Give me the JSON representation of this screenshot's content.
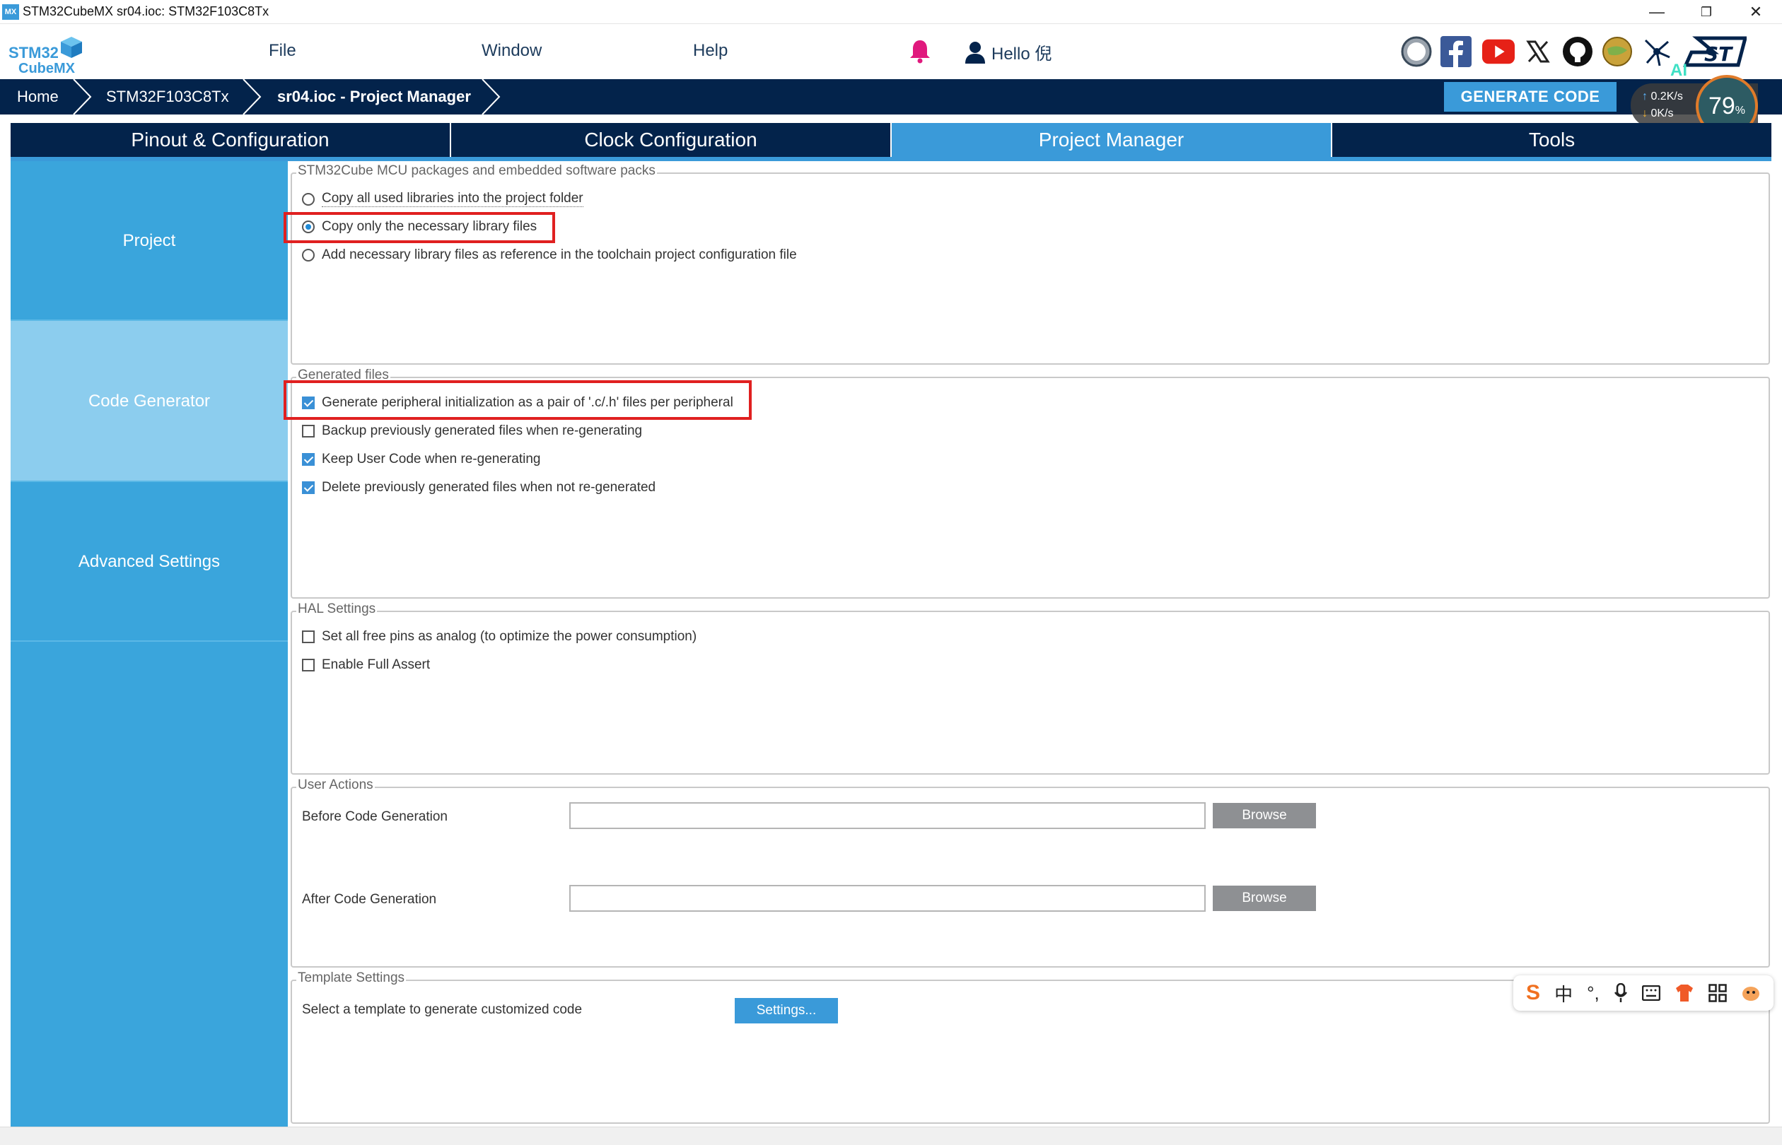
{
  "window": {
    "app_icon_text": "MX",
    "title": "STM32CubeMX sr04.ioc: STM32F103C8Tx",
    "minimize_glyph": "—",
    "maximize_glyph": "❐",
    "close_glyph": "✕"
  },
  "logo": {
    "line1": "STM32",
    "line2": "CubeMX"
  },
  "menu": {
    "file": "File",
    "window": "Window",
    "help": "Help"
  },
  "user": {
    "greeting": "Hello 倪"
  },
  "breadcrumb": {
    "home": "Home",
    "mcu": "STM32F103C8Tx",
    "current": "sr04.ioc - Project Manager"
  },
  "generate_button": "GENERATE CODE",
  "net_widget": {
    "upload": "0.2K/s",
    "download": "0K/s",
    "cpu_value": "79",
    "cpu_unit": "%",
    "ai_label": "AI"
  },
  "tabs": [
    "Pinout & Configuration",
    "Clock Configuration",
    "Project Manager",
    "Tools"
  ],
  "sidebar": {
    "items": [
      "Project",
      "Code Generator",
      "Advanced Settings"
    ]
  },
  "packages": {
    "legend": "STM32Cube MCU packages and embedded software packs",
    "options": [
      "Copy all used libraries into the project folder",
      "Copy only the necessary library files",
      "Add necessary library files as reference in the toolchain project configuration file"
    ],
    "selected_index": 1
  },
  "generated_files": {
    "legend": "Generated files",
    "options": [
      {
        "label": "Generate peripheral initialization as a pair of '.c/.h' files per peripheral",
        "checked": true
      },
      {
        "label": "Backup previously generated files when re-generating",
        "checked": false
      },
      {
        "label": "Keep User Code when re-generating",
        "checked": true
      },
      {
        "label": "Delete previously generated files when not re-generated",
        "checked": true
      }
    ]
  },
  "hal_settings": {
    "legend": "HAL Settings",
    "options": [
      {
        "label": "Set all free pins as analog (to optimize the power consumption)",
        "checked": false
      },
      {
        "label": "Enable Full Assert",
        "checked": false
      }
    ]
  },
  "user_actions": {
    "legend": "User Actions",
    "before_label": "Before Code Generation",
    "before_value": "",
    "after_label": "After Code Generation",
    "after_value": "",
    "browse_label": "Browse"
  },
  "template_settings": {
    "legend": "Template Settings",
    "description": "Select a template to generate customized code",
    "button": "Settings..."
  },
  "ime_toolbar": {
    "lang": "中"
  },
  "colors": {
    "navy": "#03234b",
    "accent": "#3a9ad9",
    "highlight": "#e02020"
  }
}
